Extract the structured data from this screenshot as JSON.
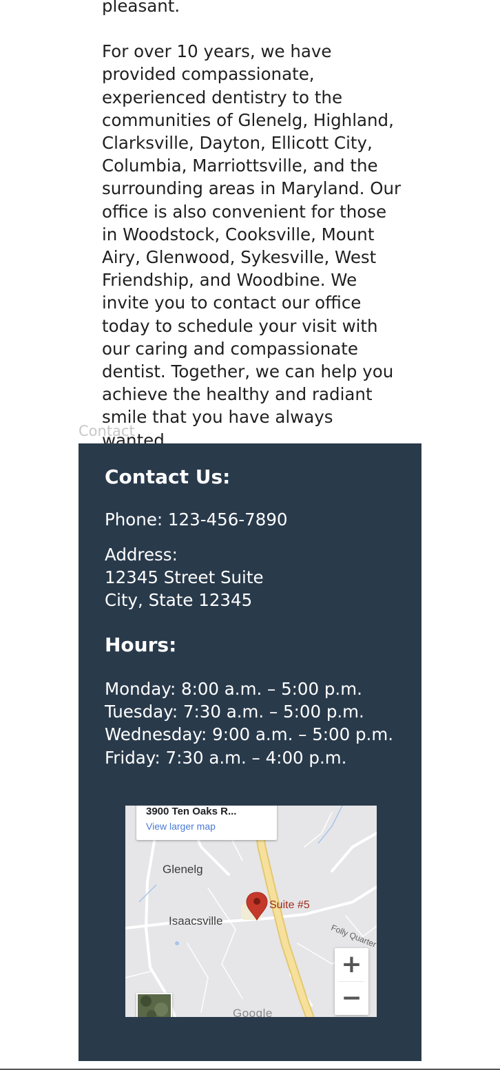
{
  "intro": {
    "partial_line": "pleasant.",
    "paragraph": "For over 10 years, we have provided compassionate, experienced dentistry to the communities of Glenelg, Highland, Clarksville, Dayton, Ellicott City, Columbia, Marriottsville, and the surrounding areas in Maryland. Our office is also convenient for those in Woodstock, Cooksville, Mount Airy, Glenwood, Sykesville, West Friendship, and Woodbine. We invite you to contact our office today to schedule your visit with our caring and compassionate dentist. Together, we can help you achieve the healthy and radiant smile that you have always wanted."
  },
  "section_anchor": "Contact",
  "contact": {
    "heading": "Contact Us:",
    "phone": "Phone: 123-456-7890",
    "address_label": "Address:",
    "address_line1": "12345 Street Suite",
    "address_line2": "City, State 12345",
    "hours_heading": "Hours:",
    "hours": [
      "Monday: 8:00 a.m. – 5:00 p.m.",
      "Tuesday: 7:30 a.m. – 5:00 p.m.",
      "Wednesday: 9:00 a.m. – 5:00 p.m.",
      "Friday: 7:30 a.m. – 4:00 p.m."
    ],
    "panel_color": "#293a4b"
  },
  "map": {
    "place_name": "3900 Ten Oaks R...",
    "larger_map_link": "View larger map",
    "labels": {
      "glenelg": "Glenelg",
      "isaacsville": "Isaacsville",
      "folly": "Folly Quarter",
      "marker": "Suite #5"
    },
    "zoom_in": "+",
    "zoom_out": "−",
    "logo": "Google",
    "marker_color": "#c5392b"
  }
}
